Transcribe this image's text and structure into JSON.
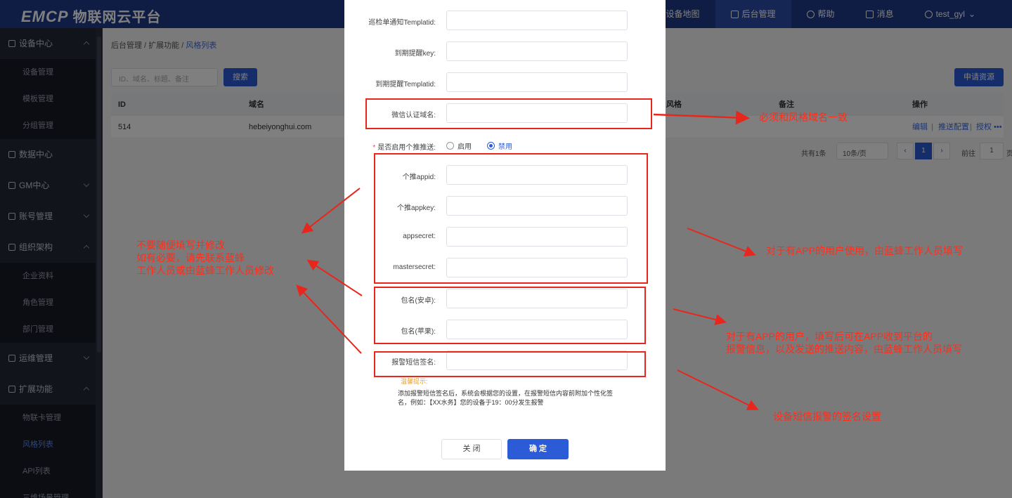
{
  "app": {
    "logo": "EMCP",
    "logo_sub": "物联网云平台"
  },
  "topnav": [
    {
      "label": "设备地图"
    },
    {
      "label": "后台管理"
    },
    {
      "label": "帮助"
    },
    {
      "label": "消息"
    },
    {
      "label": "test_gyl"
    }
  ],
  "sidebar": {
    "groups": [
      {
        "label": "设备中心",
        "items": [
          "设备管理",
          "模板管理",
          "分组管理"
        ]
      },
      {
        "label": "数据中心"
      },
      {
        "label": "GM中心"
      },
      {
        "label": "账号管理"
      },
      {
        "label": "组织架构",
        "items": [
          "企业资料",
          "角色管理",
          "部门管理"
        ]
      },
      {
        "label": "运维管理"
      },
      {
        "label": "扩展功能",
        "items": [
          "物联卡管理",
          "风格列表",
          "API列表",
          "三维场景管理"
        ]
      }
    ]
  },
  "page": {
    "breadcrumb": {
      "a": "后台管理",
      "b": "扩展功能",
      "c": "风格列表",
      "sep": "/"
    },
    "search_placeholder": "ID、域名、标题、备注",
    "search_button": "搜索",
    "apply_button": "申请资源",
    "table": {
      "headers": [
        "ID",
        "域名",
        "风格",
        "备注",
        "操作"
      ],
      "row": {
        "id": "514",
        "domain": "hebeiyonghui.com",
        "ops": [
          "编辑",
          "推送配置",
          "授权",
          "•••"
        ]
      }
    },
    "pager": {
      "total": "共有1条",
      "size": "10条/页",
      "page": "1",
      "goto": "前往",
      "goto_val": "1",
      "unit": "页"
    }
  },
  "modal": {
    "fields": [
      {
        "label": "巡检单通知Templatid:"
      },
      {
        "label": "到期提醒key:"
      },
      {
        "label": "到期提醒Templatid:"
      },
      {
        "label": "微信认证域名:"
      },
      {
        "label": "个推appid:"
      },
      {
        "label": "个推appkey:"
      },
      {
        "label": "appsecret:"
      },
      {
        "label": "mastersecret:"
      },
      {
        "label": "包名(安卓):"
      },
      {
        "label": "包名(苹果):"
      },
      {
        "label": "报警短信签名:"
      }
    ],
    "push_label": "是否启用个推推送:",
    "push_required": "*",
    "radio_enable": "启用",
    "radio_disable": "禁用",
    "hint_title": "温馨提示:",
    "hint_text": "添加报警短信签名后，系统会根据您的设置，在报警短信内容前附加个性化签名，例如：【XX水务】您的设备于19：00分发生报警",
    "btn_close": "关 闭",
    "btn_ok": "确 定"
  },
  "annotations": {
    "a1": "必须和风格域名一致",
    "a2_l1": "不要随便填写并修改",
    "a2_l2": "如有必要，请先联系蓝蜂",
    "a2_l3": "工作人员或由蓝蜂工作人员修改",
    "a3": "对于有APP的用户使用，由蓝蜂工作人员填写",
    "a4_l1": "对于有APP的用户，填写后可在APP收到平台的",
    "a4_l2": "报警信息，以及发送的推送内容，由蓝蜂工作人员填写",
    "a5": "设备短信报警的签名设置",
    "color": "#ff2d1a"
  }
}
